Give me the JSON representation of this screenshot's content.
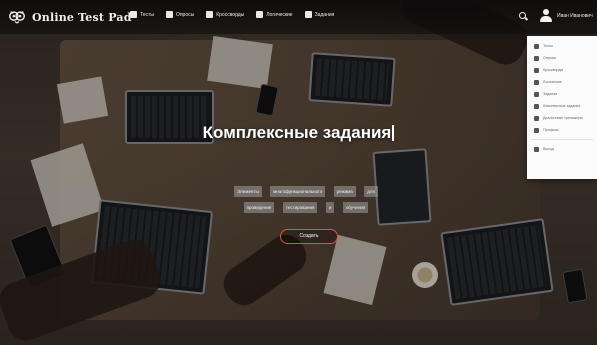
{
  "brand": {
    "name": "Online Test Pad",
    "logo_icon": "owl-logo-icon"
  },
  "nav": {
    "items": [
      {
        "label": "Тесты",
        "icon": "document-icon"
      },
      {
        "label": "Опросы",
        "icon": "poll-icon"
      },
      {
        "label": "Кроссворды",
        "icon": "crossword-icon"
      },
      {
        "label": "Логические",
        "icon": "logic-icon"
      },
      {
        "label": "Задания",
        "icon": "tasks-icon"
      }
    ],
    "search_icon": "search-icon"
  },
  "user": {
    "name": "Иван Иванович",
    "icon": "user-icon"
  },
  "dropdown": {
    "items": [
      {
        "label": "Тесты"
      },
      {
        "label": "Опросы"
      },
      {
        "label": "Кроссворды"
      },
      {
        "label": "Логические"
      },
      {
        "label": "Задания"
      },
      {
        "label": "Комплексные задания"
      },
      {
        "label": "Диалоговые тренажеры"
      },
      {
        "label": "Профиль"
      },
      {
        "label": "Выход"
      }
    ]
  },
  "hero": {
    "title": "Комплексные задания",
    "tagline_words": [
      "Элементы",
      "многофункционального",
      "режима",
      "для",
      "проведения",
      "тестирования",
      "и",
      "обучения"
    ],
    "button_label": "Создать"
  },
  "colors": {
    "accent": "#e1562c",
    "navbar": "#0a0a0a",
    "dropdown_bg": "#fbfbfb"
  }
}
